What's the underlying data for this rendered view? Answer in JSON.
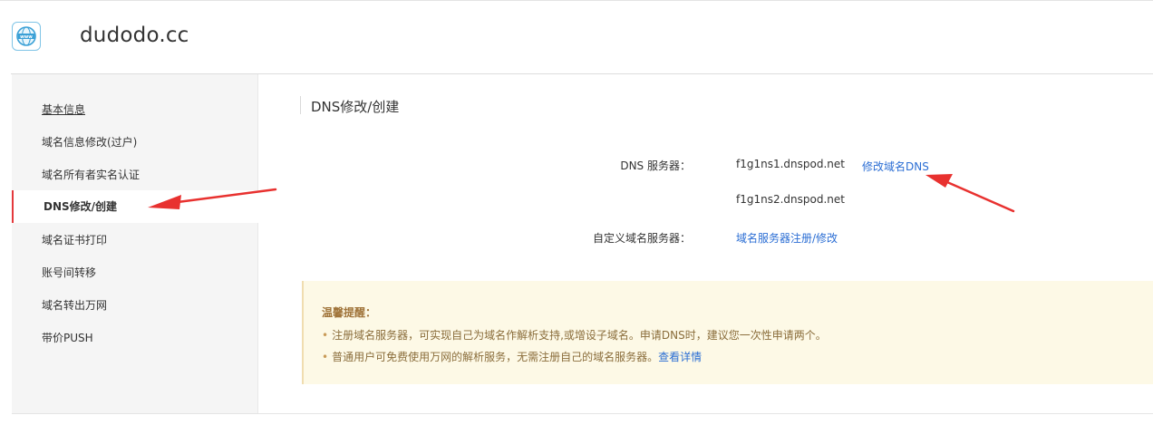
{
  "header": {
    "domain": "dudodo.cc",
    "logo_text": "www"
  },
  "sidebar": {
    "items": [
      {
        "label": "基本信息"
      },
      {
        "label": "域名信息修改(过户)"
      },
      {
        "label": "域名所有者实名认证"
      },
      {
        "label": "DNS修改/创建"
      },
      {
        "label": "域名证书打印"
      },
      {
        "label": "账号间转移"
      },
      {
        "label": "域名转出万网"
      },
      {
        "label": "带价PUSH"
      }
    ],
    "active_index": 3
  },
  "main": {
    "title": "DNS修改/创建",
    "dns_label": "DNS 服务器：",
    "dns_servers": [
      "f1g1ns1.dnspod.net",
      "f1g1ns2.dnspod.net"
    ],
    "modify_dns_link": "修改域名DNS",
    "custom_label": "自定义域名服务器：",
    "custom_link": "域名服务器注册/修改"
  },
  "notice": {
    "title": "温馨提醒：",
    "line1": "注册域名服务器，可实现自己为域名作解析支持,或增设子域名。申请DNS时，建议您一次性申请两个。",
    "line2": "普通用户可免费使用万网的解析服务，无需注册自己的域名服务器。",
    "line2_link": "查看详情",
    "bullet": "•"
  },
  "colors": {
    "accent_red": "#e4393c",
    "link_blue": "#2b6ed4",
    "notice_bg": "#fdf9e6",
    "annotation_arrow": "#e8312f"
  }
}
